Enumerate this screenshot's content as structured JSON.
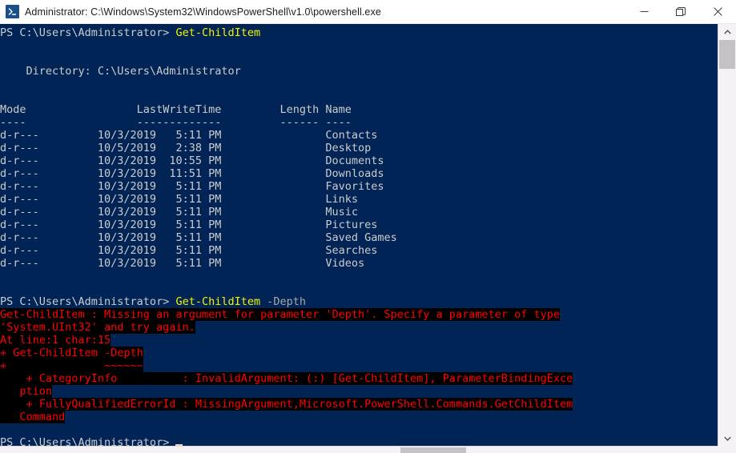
{
  "window": {
    "title": "Administrator: C:\\Windows\\System32\\WindowsPowerShell\\v1.0\\powershell.exe",
    "icon": "powershell-icon",
    "minimize_label": "Minimize",
    "maximize_label": "Maximize",
    "close_label": "Close",
    "bg_color": "#012456",
    "error_color": "#ff0000",
    "command_color": "#f3f300"
  },
  "terminal": {
    "prompt": "PS C:\\Users\\Administrator>",
    "lines": [
      {
        "type": "prompt",
        "prompt": "PS C:\\Users\\Administrator> ",
        "command": "Get-ChildItem",
        "args": ""
      },
      {
        "type": "blank",
        "text": ""
      },
      {
        "type": "plain",
        "text": ""
      },
      {
        "type": "plain",
        "text": "    Directory: C:\\Users\\Administrator"
      },
      {
        "type": "plain",
        "text": ""
      },
      {
        "type": "plain",
        "text": ""
      },
      {
        "type": "plain",
        "text": "Mode                 LastWriteTime         Length Name"
      },
      {
        "type": "plain",
        "text": "----                 -------------         ------ ----"
      },
      {
        "type": "plain",
        "text": "d-r---         10/3/2019   5:11 PM                Contacts"
      },
      {
        "type": "plain",
        "text": "d-r---         10/5/2019   2:38 PM                Desktop"
      },
      {
        "type": "plain",
        "text": "d-r---         10/3/2019  10:55 PM                Documents"
      },
      {
        "type": "plain",
        "text": "d-r---         10/3/2019  11:51 PM                Downloads"
      },
      {
        "type": "plain",
        "text": "d-r---         10/3/2019   5:11 PM                Favorites"
      },
      {
        "type": "plain",
        "text": "d-r---         10/3/2019   5:11 PM                Links"
      },
      {
        "type": "plain",
        "text": "d-r---         10/3/2019   5:11 PM                Music"
      },
      {
        "type": "plain",
        "text": "d-r---         10/3/2019   5:11 PM                Pictures"
      },
      {
        "type": "plain",
        "text": "d-r---         10/3/2019   5:11 PM                Saved Games"
      },
      {
        "type": "plain",
        "text": "d-r---         10/3/2019   5:11 PM                Searches"
      },
      {
        "type": "plain",
        "text": "d-r---         10/3/2019   5:11 PM                Videos"
      },
      {
        "type": "plain",
        "text": ""
      },
      {
        "type": "plain",
        "text": ""
      },
      {
        "type": "prompt",
        "prompt": "PS C:\\Users\\Administrator> ",
        "command": "Get-ChildItem",
        "args": " -Depth"
      },
      {
        "type": "error",
        "text": "Get-ChildItem : Missing an argument for parameter 'Depth'. Specify a parameter of type"
      },
      {
        "type": "error",
        "text": "'System.UInt32' and try again."
      },
      {
        "type": "error",
        "text": "At line:1 char:15"
      },
      {
        "type": "error",
        "text": "+ Get-ChildItem -Depth"
      },
      {
        "type": "error",
        "text": "+               ~~~~~~"
      },
      {
        "type": "error",
        "text": "    + CategoryInfo          : InvalidArgument: (:) [Get-ChildItem], ParameterBindingExce"
      },
      {
        "type": "error",
        "text": "   ption"
      },
      {
        "type": "error",
        "text": "    + FullyQualifiedErrorId : MissingArgument,Microsoft.PowerShell.Commands.GetChildItem"
      },
      {
        "type": "error",
        "text": "   Command"
      },
      {
        "type": "plain",
        "text": ""
      },
      {
        "type": "final",
        "prompt": "PS C:\\Users\\Administrator> ",
        "command": "",
        "args": ""
      }
    ]
  },
  "scrollbars": {
    "vertical_up": "scroll-up",
    "vertical_down": "scroll-down",
    "horizontal": "horizontal-scrollbar"
  }
}
